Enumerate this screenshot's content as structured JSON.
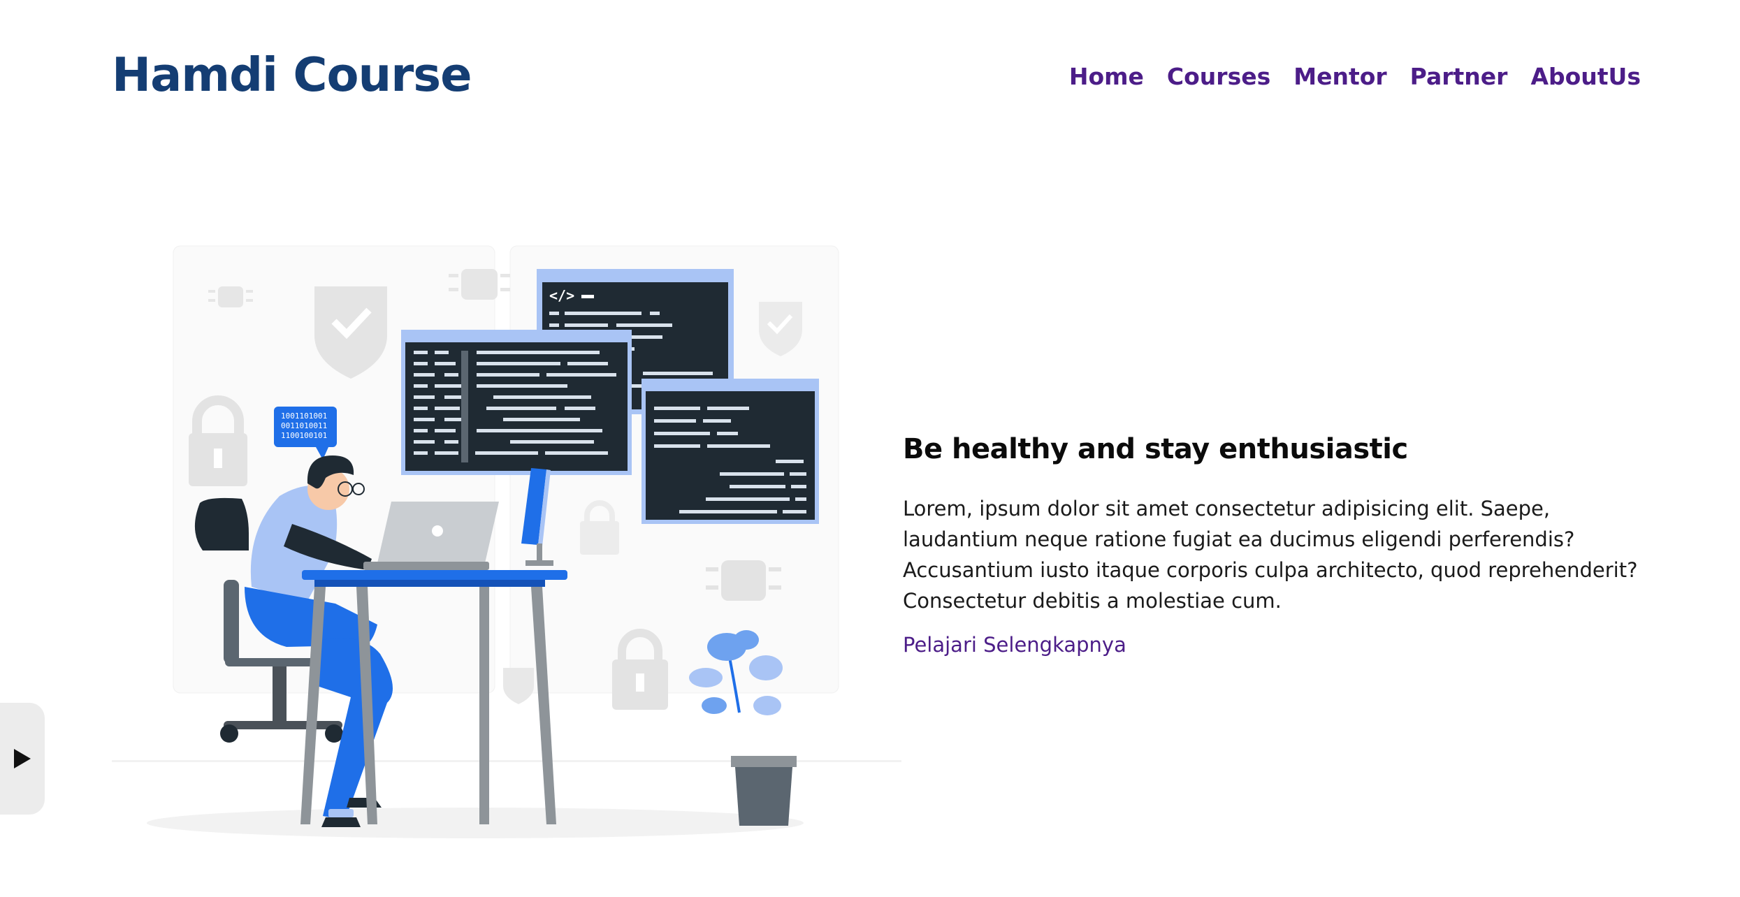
{
  "header": {
    "brand": "Hamdi Course",
    "nav": [
      "Home",
      "Courses",
      "Mentor",
      "Partner",
      "AboutUs"
    ]
  },
  "hero": {
    "illustration": "developer-at-desk-illustration",
    "bubble_text": [
      "1001101001",
      "0011010011",
      "1100100101"
    ],
    "headline": "Be healthy and stay enthusiastic",
    "description": "Lorem, ipsum dolor sit amet consectetur adipisicing elit. Saepe, laudantium neque ratione fugiat ea ducimus eligendi perferendis? Accusantium iusto itaque corporis culpa architecto, quod reprehenderit? Consectetur debitis a molestiae cum.",
    "link": "Pelajari Selengkapnya"
  },
  "side_tab": {
    "icon": "play-icon"
  },
  "colors": {
    "brand": "#143d73",
    "nav": "#4c1d88",
    "accent_blue": "#1f6fe8",
    "panel_dark": "#1f2a33",
    "panel_frame": "#a9c4f5"
  }
}
